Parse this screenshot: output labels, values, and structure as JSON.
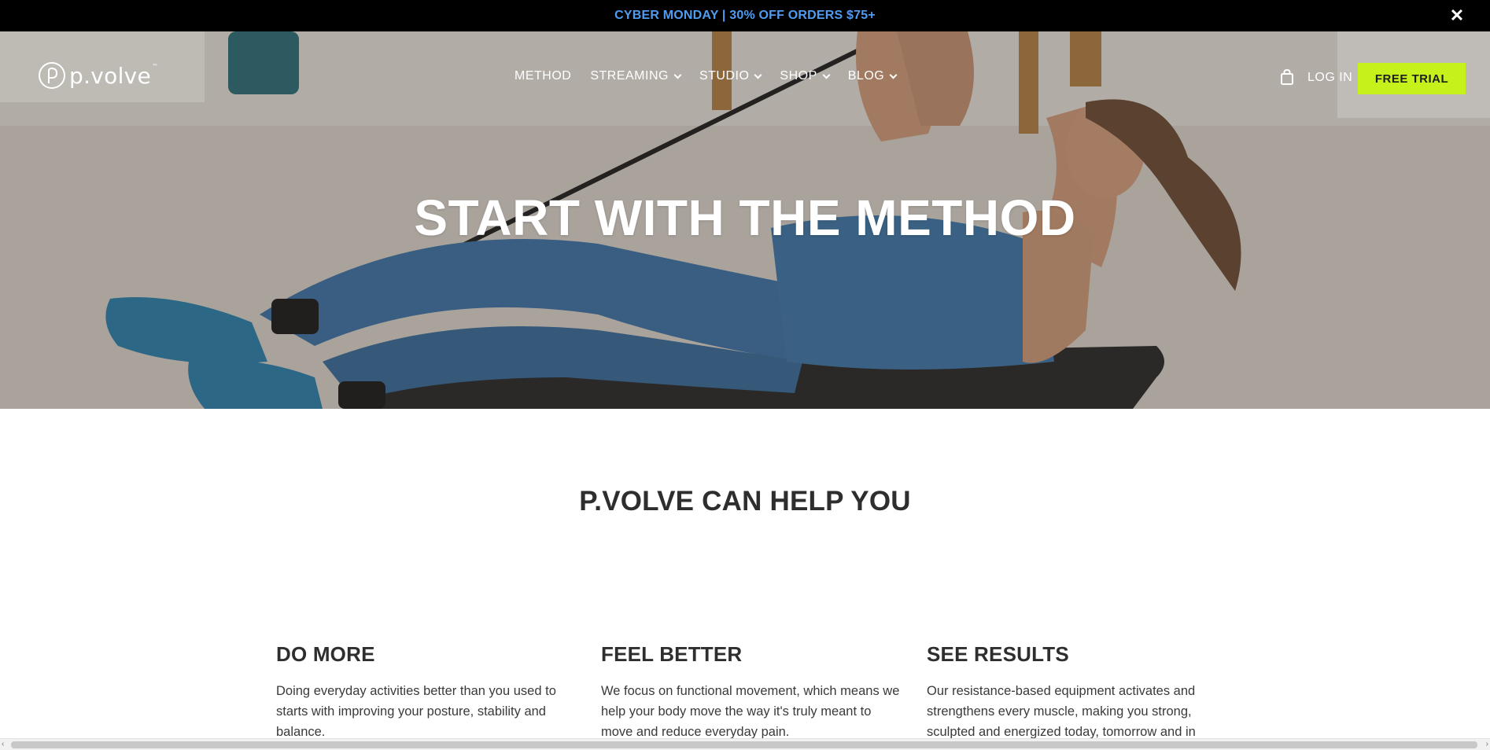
{
  "promo": {
    "text": "CYBER MONDAY | 30% OFF ORDERS $75+",
    "close_icon": "close-icon",
    "text_color": "#4f9cf0"
  },
  "header": {
    "logo_text": "p.volve",
    "logo_tm": "™",
    "nav": [
      {
        "label": "METHOD",
        "has_dropdown": false
      },
      {
        "label": "STREAMING",
        "has_dropdown": true
      },
      {
        "label": "STUDIO",
        "has_dropdown": true
      },
      {
        "label": "SHOP",
        "has_dropdown": true
      },
      {
        "label": "BLOG",
        "has_dropdown": true
      }
    ],
    "cart_icon": "shopping-bag-icon",
    "login_label": "LOG IN",
    "trial_label": "FREE TRIAL",
    "accent": "#c6f21b"
  },
  "hero": {
    "title": "START WITH THE METHOD"
  },
  "main": {
    "section_title": "P.VOLVE CAN HELP YOU",
    "columns": [
      {
        "heading": "DO MORE",
        "text": "Doing everyday activities better than you used to starts with improving your posture, stability and balance."
      },
      {
        "heading": "FEEL BETTER",
        "text": "We focus on functional movement, which means we help your body move the way it's truly meant to move and reduce everyday pain."
      },
      {
        "heading": "SEE RESULTS",
        "text": "Our resistance-based equipment activates and strengthens every muscle, making you strong, sculpted and energized today, tomorrow and in"
      }
    ]
  }
}
